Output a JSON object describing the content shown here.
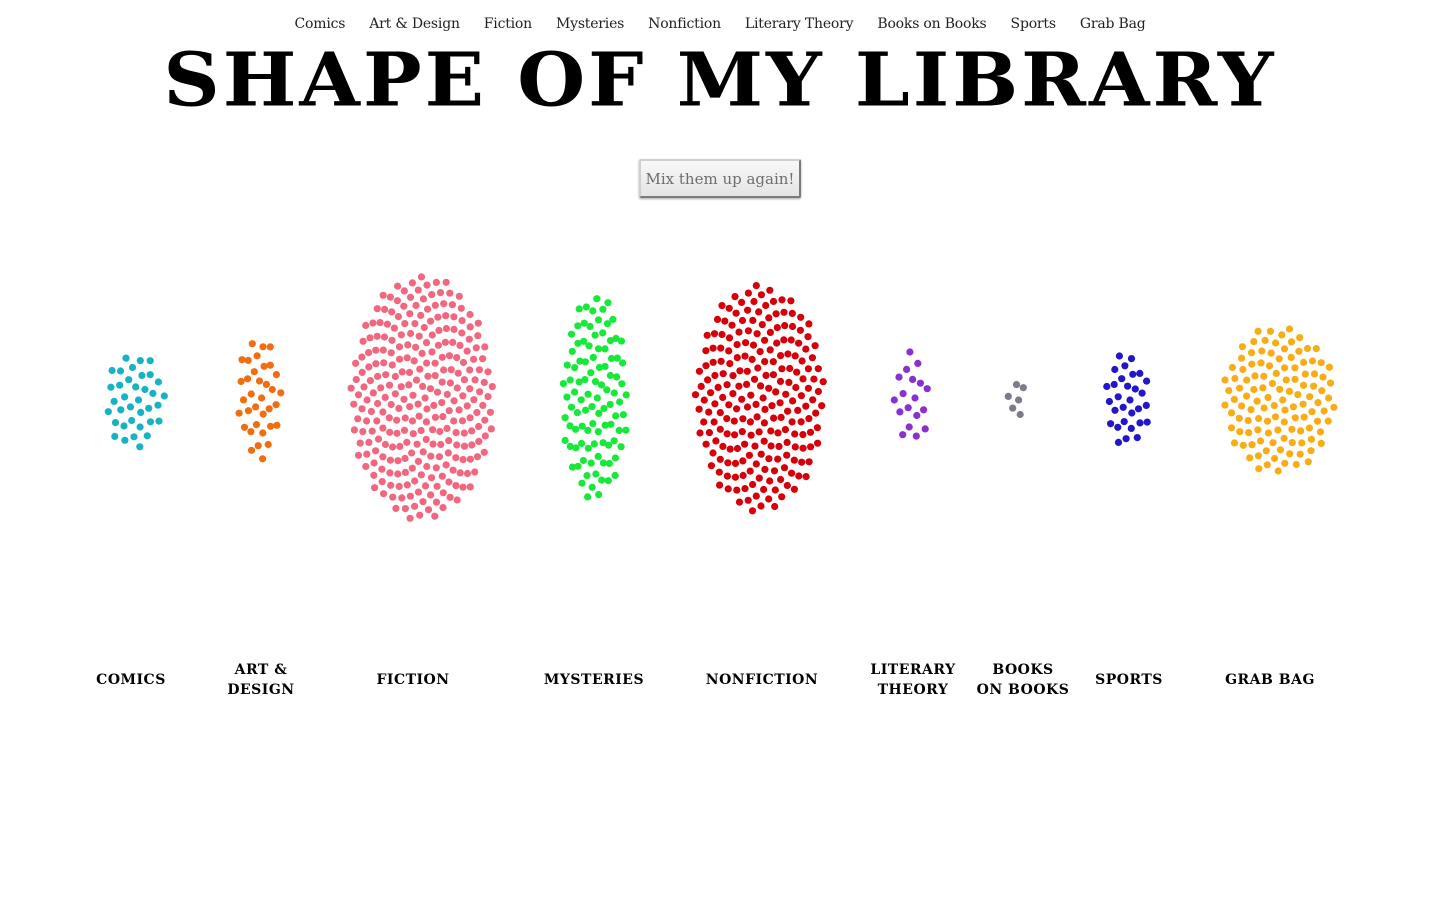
{
  "nav": {
    "items": [
      "Comics",
      "Art & Design",
      "Fiction",
      "Mysteries",
      "Nonfiction",
      "Literary Theory",
      "Books on Books",
      "Sports",
      "Grab Bag"
    ]
  },
  "header": {
    "title": "SHAPE OF MY LIBRARY"
  },
  "controls": {
    "mix_button_label": "Mix them up again!"
  },
  "chart_data": {
    "type": "scatter",
    "title": "SHAPE OF MY LIBRARY",
    "description_of_marks": "one dot per book, clustered by category",
    "categories": [
      {
        "name": "Comics",
        "label_lines": [
          "COMICS"
        ],
        "count": 36,
        "color": "#17b3c3"
      },
      {
        "name": "Art & Design",
        "label_lines": [
          "ART &",
          "DESIGN"
        ],
        "count": 35,
        "color": "#f26d0f"
      },
      {
        "name": "Fiction",
        "label_lines": [
          "FICTION"
        ],
        "count": 278,
        "color": "#f0677f"
      },
      {
        "name": "Mysteries",
        "label_lines": [
          "MYSTERIES"
        ],
        "count": 100,
        "color": "#18e83a"
      },
      {
        "name": "Nonfiction",
        "label_lines": [
          "NONFICTION"
        ],
        "count": 220,
        "color": "#d6000a"
      },
      {
        "name": "Literary Theory",
        "label_lines": [
          "LITERARY",
          "THEORY"
        ],
        "count": 18,
        "color": "#8a2fd0"
      },
      {
        "name": "Books on Books",
        "label_lines": [
          "BOOKS",
          "ON BOOKS"
        ],
        "count": 6,
        "color": "#7c7a8c"
      },
      {
        "name": "Sports",
        "label_lines": [
          "SPORTS"
        ],
        "count": 30,
        "color": "#2117c9"
      },
      {
        "name": "Grab Bag",
        "label_lines": [
          "GRAB BAG"
        ],
        "count": 118,
        "color": "#f8ad17"
      }
    ]
  }
}
